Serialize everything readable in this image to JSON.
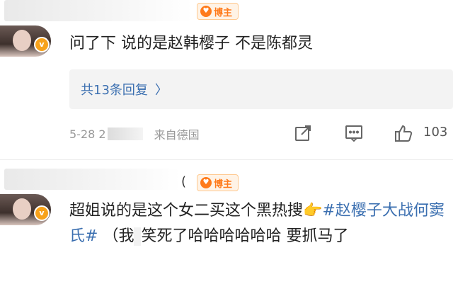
{
  "comments": [
    {
      "blogger_tag": "博主",
      "verified_badge": "v",
      "text": "问了下 说的是赵韩樱子 不是陈都灵",
      "replies_label": "共13条回复",
      "timestamp": "5-28 2",
      "location": "来自德国",
      "like_count": "103"
    },
    {
      "blogger_tag": "博主",
      "verified_badge": "v",
      "text_a": "超姐说的是这个女二买这个黑热搜👉",
      "topic": "#赵樱子大战何窦氏#",
      "text_b": "（我",
      "text_c": "笑死了哈哈哈哈哈哈 要抓马了",
      "paren": "("
    }
  ],
  "colors": {
    "link_blue": "#3b6fb0",
    "blogger_orange": "#ff7a1a",
    "badge_gold": "#f7a21b",
    "meta_gray": "#999999"
  },
  "icons": {
    "share": "share-icon",
    "comment": "comment-icon",
    "like": "like-icon",
    "chevron": "chevron-right-icon"
  }
}
